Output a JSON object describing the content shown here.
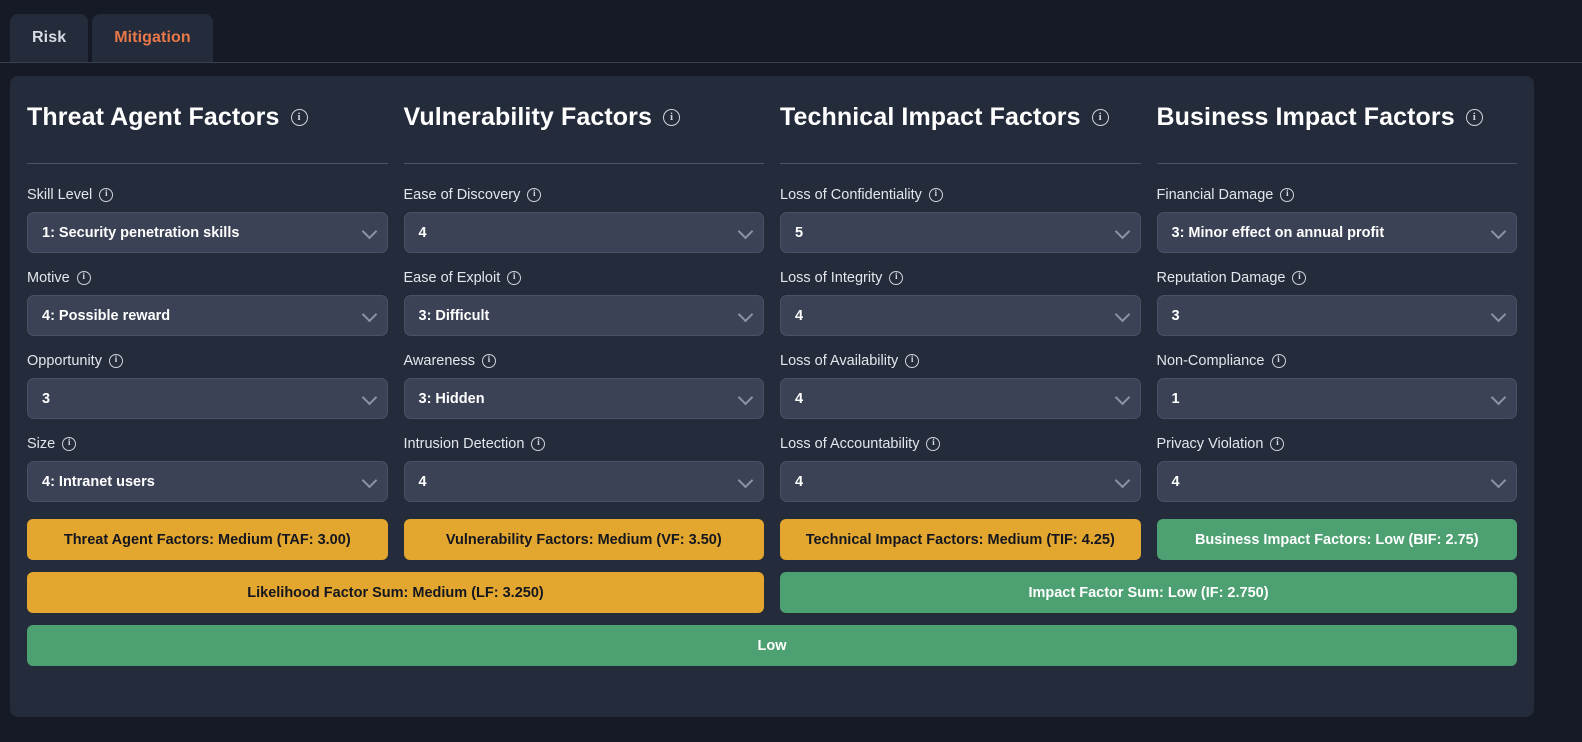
{
  "tabs": [
    {
      "label": "Risk",
      "active": false
    },
    {
      "label": "Mitigation",
      "active": true
    }
  ],
  "colors": {
    "page_bg": "#151a26",
    "card_bg": "#242b3a",
    "select_bg": "#3b4256",
    "amber": "#e3a62f",
    "green": "#4da071",
    "active_tab_text": "#e8784a"
  },
  "info_icon": "i",
  "columns": [
    {
      "title": "Threat Agent Factors",
      "info_icon": "info-icon",
      "fields": [
        {
          "label": "Skill Level",
          "value": "1: Security penetration skills"
        },
        {
          "label": "Motive",
          "value": "4: Possible reward"
        },
        {
          "label": "Opportunity",
          "value": "3"
        },
        {
          "label": "Size",
          "value": "4: Intranet users"
        }
      ],
      "summary": {
        "text": "Threat Agent Factors: Medium (TAF: 3.00)",
        "level": "Medium",
        "score": "3.00",
        "tone": "amber"
      }
    },
    {
      "title": "Vulnerability Factors",
      "info_icon": "info-icon",
      "fields": [
        {
          "label": "Ease of Discovery",
          "value": "4"
        },
        {
          "label": "Ease of Exploit",
          "value": "3: Difficult"
        },
        {
          "label": "Awareness",
          "value": "3: Hidden"
        },
        {
          "label": "Intrusion Detection",
          "value": "4"
        }
      ],
      "summary": {
        "text": "Vulnerability Factors: Medium (VF: 3.50)",
        "level": "Medium",
        "score": "3.50",
        "tone": "amber"
      }
    },
    {
      "title": "Technical Impact Factors",
      "info_icon": "info-icon",
      "fields": [
        {
          "label": "Loss of Confidentiality",
          "value": "5"
        },
        {
          "label": "Loss of Integrity",
          "value": "4"
        },
        {
          "label": "Loss of Availability",
          "value": "4"
        },
        {
          "label": "Loss of Accountability",
          "value": "4"
        }
      ],
      "summary": {
        "text": "Technical Impact Factors: Medium (TIF: 4.25)",
        "level": "Medium",
        "score": "4.25",
        "tone": "amber"
      }
    },
    {
      "title": "Business Impact Factors",
      "info_icon": "info-icon",
      "fields": [
        {
          "label": "Financial Damage",
          "value": "3: Minor effect on annual profit"
        },
        {
          "label": "Reputation Damage",
          "value": "3"
        },
        {
          "label": "Non-Compliance",
          "value": "1"
        },
        {
          "label": "Privacy Violation",
          "value": "4"
        }
      ],
      "summary": {
        "text": "Business Impact Factors: Low (BIF: 2.75)",
        "level": "Low",
        "score": "2.75",
        "tone": "green"
      }
    }
  ],
  "sums": [
    {
      "text": "Likelihood Factor Sum: Medium (LF: 3.250)",
      "level": "Medium",
      "score": "3.250",
      "tone": "amber"
    },
    {
      "text": "Impact Factor Sum: Low (IF: 2.750)",
      "level": "Low",
      "score": "2.750",
      "tone": "green"
    }
  ],
  "overall": {
    "text": "Low",
    "tone": "green"
  }
}
